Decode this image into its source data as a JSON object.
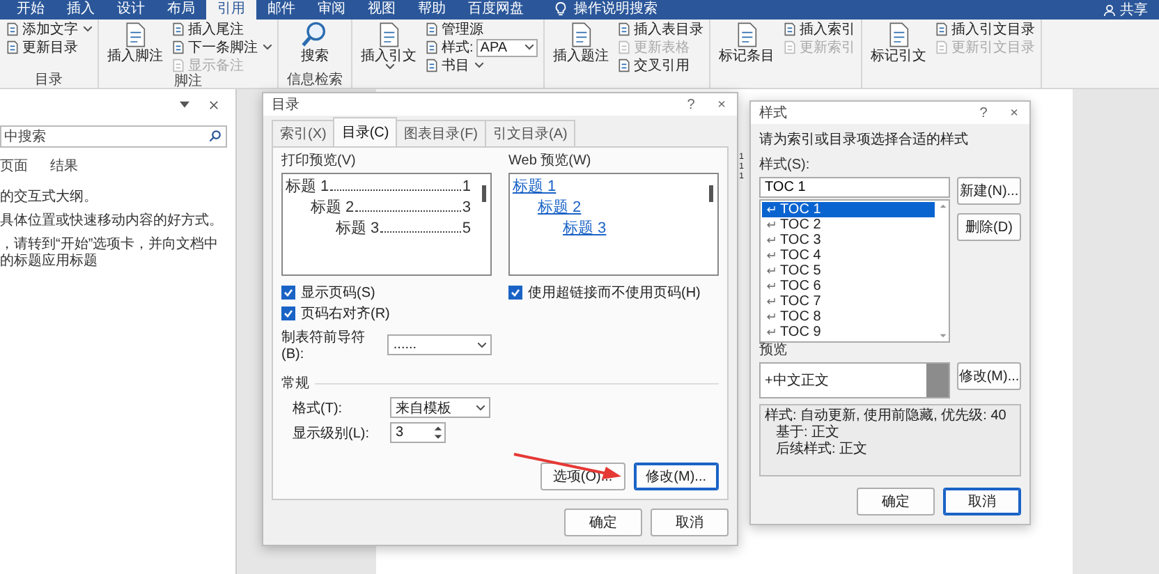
{
  "tabs": [
    {
      "label": "开始",
      "selected": false
    },
    {
      "label": "插入",
      "selected": false
    },
    {
      "label": "设计",
      "selected": false
    },
    {
      "label": "布局",
      "selected": false
    },
    {
      "label": "引用",
      "selected": true
    },
    {
      "label": "邮件",
      "selected": false
    },
    {
      "label": "审阅",
      "selected": false
    },
    {
      "label": "视图",
      "selected": false
    },
    {
      "label": "帮助",
      "selected": false
    },
    {
      "label": "百度网盘",
      "selected": false
    }
  ],
  "tell_me": "操作说明搜索",
  "share": "共享",
  "ribbon_groups": [
    {
      "label": "目录",
      "columns": [
        [
          {
            "kind": "small",
            "label": "添加文字",
            "dropdown": true,
            "disabled": false
          },
          {
            "kind": "small",
            "label": "更新目录",
            "dropdown": false,
            "disabled": false
          }
        ]
      ]
    },
    {
      "label": "脚注",
      "columns": [
        [
          {
            "kind": "large",
            "label": "插入脚注",
            "dropdown": false,
            "disabled": false
          }
        ],
        [
          {
            "kind": "small",
            "label": "插入尾注",
            "dropdown": false,
            "disabled": false
          },
          {
            "kind": "small",
            "label": "下一条脚注",
            "dropdown": true,
            "disabled": false
          },
          {
            "kind": "small",
            "label": "显示备注",
            "dropdown": false,
            "disabled": true
          }
        ]
      ]
    },
    {
      "label": "信息检索",
      "columns": [
        [
          {
            "kind": "large",
            "label": "搜索",
            "dropdown": false,
            "disabled": false
          }
        ]
      ]
    },
    {
      "columns": [
        [
          {
            "kind": "large",
            "label": "插入引文",
            "dropdown": true,
            "disabled": false
          }
        ],
        [
          {
            "kind": "small",
            "label": "管理源",
            "dropdown": false,
            "disabled": false
          },
          {
            "kind": "select",
            "label": "样式:",
            "value": "APA",
            "dropdown": true,
            "disabled": false
          },
          {
            "kind": "small",
            "label": "书目",
            "dropdown": true,
            "disabled": false
          }
        ]
      ]
    },
    {
      "columns": [
        [
          {
            "kind": "large",
            "label": "插入题注",
            "dropdown": false,
            "disabled": false
          }
        ],
        [
          {
            "kind": "small",
            "label": "插入表目录",
            "dropdown": false,
            "disabled": false
          },
          {
            "kind": "small",
            "label": "更新表格",
            "dropdown": false,
            "disabled": true
          },
          {
            "kind": "small",
            "label": "交叉引用",
            "dropdown": false,
            "disabled": false
          }
        ]
      ]
    },
    {
      "columns": [
        [
          {
            "kind": "large",
            "label": "标记条目",
            "dropdown": false,
            "disabled": false
          }
        ],
        [
          {
            "kind": "small",
            "label": "插入索引",
            "dropdown": false,
            "disabled": false
          },
          {
            "kind": "small",
            "label": "更新索引",
            "dropdown": false,
            "disabled": true
          }
        ]
      ]
    },
    {
      "columns": [
        [
          {
            "kind": "large",
            "label": "标记引文",
            "dropdown": false,
            "disabled": false
          }
        ],
        [
          {
            "kind": "small",
            "label": "插入引文目录",
            "dropdown": false,
            "disabled": false
          },
          {
            "kind": "small",
            "label": "更新引文目录",
            "dropdown": false,
            "disabled": true
          }
        ]
      ]
    }
  ],
  "nav_pane": {
    "search": {
      "placeholder": "中搜索"
    },
    "tabs": [
      {
        "label": "页面",
        "selected": false
      },
      {
        "label": "结果",
        "selected": false
      }
    ],
    "hints": [
      "的交互式大纲。",
      "具体位置或快速移动内容的好方式。",
      "，请转到“开始”选项卡，并向文档中的标题应用标题"
    ]
  },
  "document": {
    "toc_page_numbers": [
      "1",
      "1",
      "1"
    ]
  },
  "toc_dialog": {
    "title": "目录",
    "help": "?",
    "close": "×",
    "tabs": [
      {
        "label": "索引(X)",
        "selected": false
      },
      {
        "label": "目录(C)",
        "selected": true
      },
      {
        "label": "图表目录(F)",
        "selected": false
      },
      {
        "label": "引文目录(A)",
        "selected": false
      }
    ],
    "print_preview": {
      "label": "打印预览(V)",
      "entries": [
        {
          "text": "标题 1",
          "page": "1",
          "children": [
            {
              "text": "标题 2",
              "page": "3",
              "children": [
                {
                  "text": "标题 3",
                  "page": "5"
                }
              ]
            }
          ]
        }
      ]
    },
    "web_preview": {
      "label": "Web 预览(W)",
      "entries": [
        {
          "text": "标题 1",
          "children": [
            {
              "text": "标题 2",
              "children": [
                {
                  "text": "标题 3"
                }
              ]
            }
          ]
        }
      ]
    },
    "left_checks": [
      {
        "label": "显示页码(S)",
        "checked": true
      },
      {
        "label": "页码右对齐(R)",
        "checked": true
      }
    ],
    "right_checks": [
      {
        "label": "使用超链接而不使用页码(H)",
        "checked": true
      }
    ],
    "leader": {
      "label": "制表符前导符(B):",
      "value": "......"
    },
    "general": {
      "title": "常规",
      "format": {
        "label": "格式(T):",
        "value": "来自模板"
      },
      "levels": {
        "label": "显示级别(L):",
        "value": "3"
      }
    },
    "buttons": [
      {
        "label": "选项(O)...",
        "focused": false
      },
      {
        "label": "修改(M)...",
        "focused": true
      }
    ],
    "footer_buttons": [
      {
        "label": "确定",
        "focused": false
      },
      {
        "label": "取消",
        "focused": false
      }
    ]
  },
  "style_dialog": {
    "title": "样式",
    "help": "?",
    "close": "×",
    "prompt": "请为索引或目录项选择合适的样式",
    "styles_label": "样式(S):",
    "style_value": "TOC 1",
    "styles": [
      {
        "name": "TOC 1",
        "selected": true
      },
      {
        "name": "TOC 2",
        "selected": false
      },
      {
        "name": "TOC 3",
        "selected": false
      },
      {
        "name": "TOC 4",
        "selected": false
      },
      {
        "name": "TOC 5",
        "selected": false
      },
      {
        "name": "TOC 6",
        "selected": false
      },
      {
        "name": "TOC 7",
        "selected": false
      },
      {
        "name": "TOC 8",
        "selected": false
      },
      {
        "name": "TOC 9",
        "selected": false
      }
    ],
    "side_buttons": [
      "新建(N)...",
      "删除(D)"
    ],
    "preview_label": "预览",
    "preview_text": "+中文正文",
    "modify": "修改(M)...",
    "description": [
      "样式: 自动更新, 使用前隐藏, 优先级: 40",
      "基于: 正文",
      "后续样式: 正文"
    ],
    "footer_buttons": [
      {
        "label": "确定",
        "focused": false
      },
      {
        "label": "取消",
        "focused": true
      }
    ]
  }
}
